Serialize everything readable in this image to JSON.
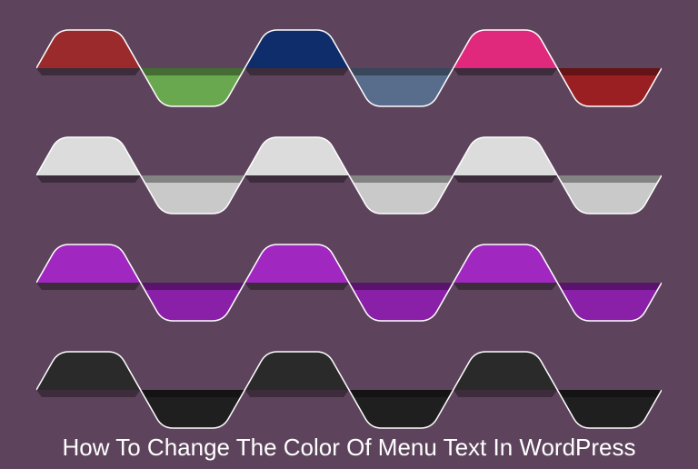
{
  "title": "How To Change The Color Of Menu Text In WordPress",
  "background": "#5d445c",
  "rows": [
    {
      "lobes": [
        {
          "dir": "up",
          "fill": "#9a2a2c"
        },
        {
          "dir": "down",
          "fill": "#6aa84f"
        },
        {
          "dir": "up",
          "fill": "#0f2c6b"
        },
        {
          "dir": "down",
          "fill": "#586c8c"
        },
        {
          "dir": "up",
          "fill": "#e0297d"
        },
        {
          "dir": "down",
          "fill": "#9a1f23"
        }
      ]
    },
    {
      "lobes": [
        {
          "dir": "up",
          "fill": "#dcdcdc"
        },
        {
          "dir": "down",
          "fill": "#c9c9c9"
        },
        {
          "dir": "up",
          "fill": "#dcdcdc"
        },
        {
          "dir": "down",
          "fill": "#c9c9c9"
        },
        {
          "dir": "up",
          "fill": "#dcdcdc"
        },
        {
          "dir": "down",
          "fill": "#c9c9c9"
        }
      ]
    },
    {
      "lobes": [
        {
          "dir": "up",
          "fill": "#a028c0"
        },
        {
          "dir": "down",
          "fill": "#8a1fa8"
        },
        {
          "dir": "up",
          "fill": "#a028c0"
        },
        {
          "dir": "down",
          "fill": "#8a1fa8"
        },
        {
          "dir": "up",
          "fill": "#a028c0"
        },
        {
          "dir": "down",
          "fill": "#8a1fa8"
        }
      ]
    },
    {
      "lobes": [
        {
          "dir": "up",
          "fill": "#2a2a2a"
        },
        {
          "dir": "down",
          "fill": "#1f1f1f"
        },
        {
          "dir": "up",
          "fill": "#2a2a2a"
        },
        {
          "dir": "down",
          "fill": "#1f1f1f"
        },
        {
          "dir": "up",
          "fill": "#2a2a2a"
        },
        {
          "dir": "down",
          "fill": "#1f1f1f"
        }
      ]
    }
  ]
}
